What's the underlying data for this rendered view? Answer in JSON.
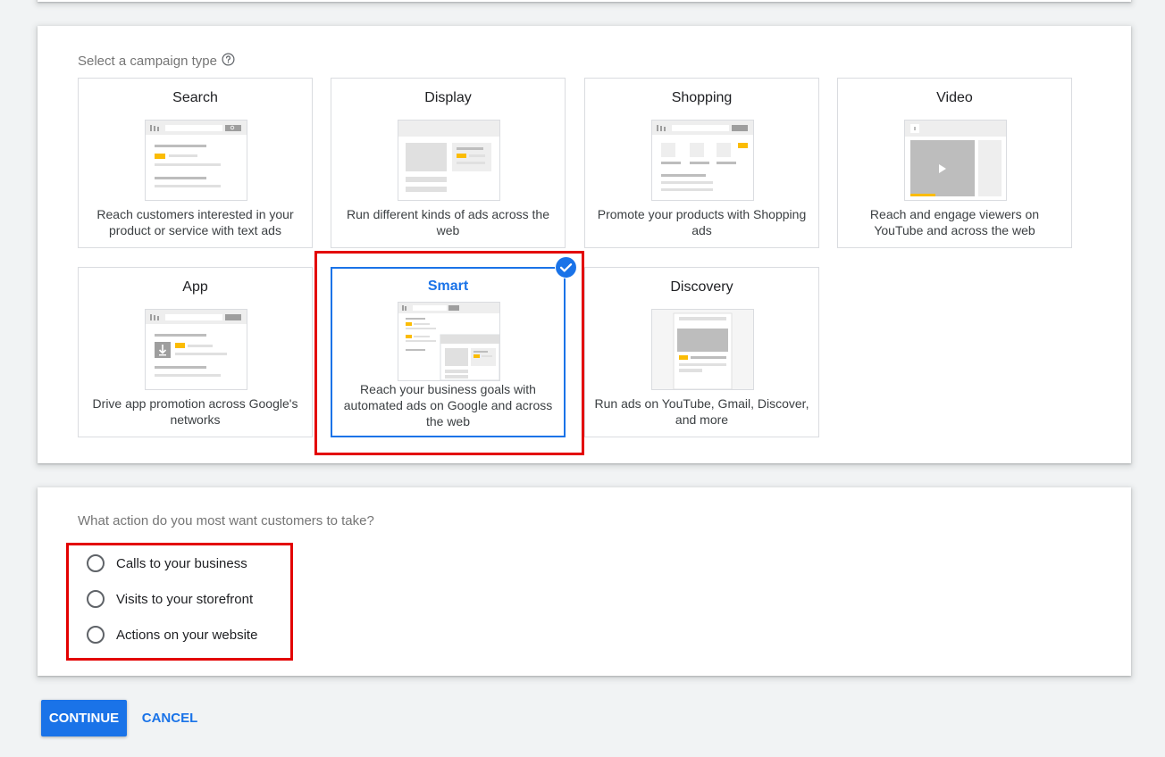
{
  "campaign_section": {
    "label": "Select a campaign type",
    "help_icon": "help-circle-icon",
    "types": [
      {
        "title": "Search",
        "description": "Reach customers interested in your product or service with text ads"
      },
      {
        "title": "Display",
        "description": "Run different kinds of ads across the web"
      },
      {
        "title": "Shopping",
        "description": "Promote your products with Shopping ads"
      },
      {
        "title": "Video",
        "description": "Reach and engage viewers on YouTube and across the web"
      },
      {
        "title": "App",
        "description": "Drive app promotion across Google's networks"
      },
      {
        "title": "Smart",
        "description": "Reach your business goals with automated ads on Google and across the web",
        "selected": true
      },
      {
        "title": "Discovery",
        "description": "Run ads on YouTube, Gmail, Discover, and more"
      }
    ]
  },
  "action_section": {
    "question": "What action do you most want customers to take?",
    "options": [
      {
        "label": "Calls to your business",
        "checked": false
      },
      {
        "label": "Visits to your storefront",
        "checked": false
      },
      {
        "label": "Actions on your website",
        "checked": false
      }
    ]
  },
  "buttons": {
    "continue_label": "CONTINUE",
    "cancel_label": "CANCEL"
  },
  "colors": {
    "accent": "#1a73e8",
    "highlight": "#e30000",
    "placeholder_yellow": "#fbbc04",
    "background": "#f1f3f4"
  }
}
